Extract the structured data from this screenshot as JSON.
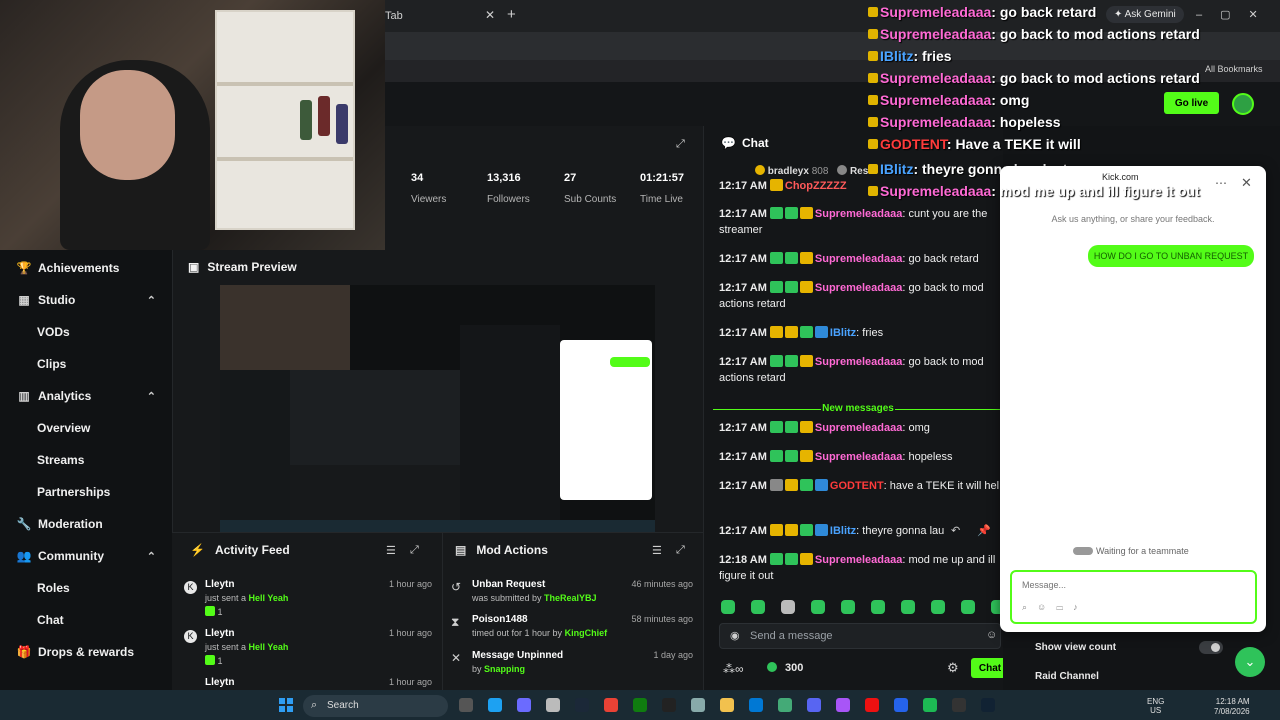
{
  "browser": {
    "tab_title": "Tab",
    "ask_gemini": "Ask Gemini",
    "all_bookmarks": "All Bookmarks",
    "go_live": "Go live"
  },
  "stats": [
    {
      "value": "34",
      "label": "Viewers"
    },
    {
      "value": "13,316",
      "label": "Followers"
    },
    {
      "value": "27",
      "label": "Sub Counts"
    },
    {
      "value": "01:21:57",
      "label": "Time Live"
    }
  ],
  "sidebar": {
    "items": [
      {
        "label": "Achievements",
        "icon": "trophy-icon"
      },
      {
        "label": "Studio",
        "icon": "studio-icon"
      },
      {
        "label": "VODs"
      },
      {
        "label": "Clips"
      },
      {
        "label": "Analytics",
        "icon": "chart-icon"
      },
      {
        "label": "Overview"
      },
      {
        "label": "Streams"
      },
      {
        "label": "Partnerships"
      },
      {
        "label": "Moderation",
        "icon": "wrench-icon"
      },
      {
        "label": "Community",
        "icon": "people-icon"
      },
      {
        "label": "Roles"
      },
      {
        "label": "Chat"
      },
      {
        "label": "Drops & rewards",
        "icon": "gift-icon"
      }
    ]
  },
  "stream_preview": {
    "title": "Stream Preview"
  },
  "activity_feed": {
    "title": "Activity Feed",
    "rows": [
      {
        "name": "Lleytn",
        "action": "just sent a",
        "item": "Hell Yeah",
        "count": "1",
        "time": "1 hour ago"
      },
      {
        "name": "Lleytn",
        "action": "just sent a",
        "item": "Hell Yeah",
        "count": "1",
        "time": "1 hour ago"
      },
      {
        "name": "Lleytn",
        "time": "1 hour ago"
      }
    ]
  },
  "mod_actions": {
    "title": "Mod Actions",
    "rows": [
      {
        "name": "Unban Request",
        "detail": "was submitted by",
        "by": "TheRealYBJ",
        "time": "46 minutes ago"
      },
      {
        "name": "Poison1488",
        "detail": "timed out for 1 hour by",
        "by": "KingChief",
        "time": "58 minutes ago"
      },
      {
        "name": "Message Unpinned",
        "detail": "by",
        "by": "Snapping",
        "time": "1 day ago"
      }
    ]
  },
  "chat": {
    "title": "Chat",
    "pinned_user": "bradleyx",
    "pinned_count": "808",
    "pinned_extra": "Resid",
    "messages": [
      {
        "time": "12:17 AM",
        "user": "ChopZZZZZ",
        "text": "",
        "color": "#ff5a5a",
        "badges": [
          "#e6b400"
        ]
      },
      {
        "time": "12:17 AM",
        "user": "Supremeleadaaa",
        "text": "cunt you are the streamer",
        "color": "#ff6ad5",
        "badges": [
          "#2fc35a",
          "#2fc35a",
          "#e6b400"
        ]
      },
      {
        "time": "12:17 AM",
        "user": "Supremeleadaaa",
        "text": "go back retard",
        "color": "#ff6ad5",
        "badges": [
          "#2fc35a",
          "#2fc35a",
          "#e6b400"
        ]
      },
      {
        "time": "12:17 AM",
        "user": "Supremeleadaaa",
        "text": "go back to mod actions retard",
        "color": "#ff6ad5",
        "badges": [
          "#2fc35a",
          "#2fc35a",
          "#e6b400"
        ]
      },
      {
        "time": "12:17 AM",
        "user": "IBlitz",
        "text": "fries",
        "color": "#4aa3ff",
        "badges": [
          "#e6b400",
          "#e6b400",
          "#2fc35a",
          "#2f8ad8"
        ]
      },
      {
        "time": "12:17 AM",
        "user": "Supremeleadaaa",
        "text": "go back to mod actions retard",
        "color": "#ff6ad5",
        "badges": [
          "#2fc35a",
          "#2fc35a",
          "#e6b400"
        ]
      },
      {
        "time": "12:17 AM",
        "user": "Supremeleadaaa",
        "text": "omg",
        "color": "#ff6ad5",
        "badges": [
          "#2fc35a",
          "#2fc35a",
          "#e6b400"
        ]
      },
      {
        "time": "12:17 AM",
        "user": "Supremeleadaaa",
        "text": "hopeless",
        "color": "#ff6ad5",
        "badges": [
          "#2fc35a",
          "#2fc35a",
          "#e6b400"
        ]
      },
      {
        "time": "12:17 AM",
        "user": "GODTENT",
        "text": "have a TEKE it will hel",
        "color": "#ff3b3b",
        "badges": [
          "#888888",
          "#e6b400",
          "#2fc35a",
          "#2f8ad8"
        ]
      },
      {
        "time": "12:17 AM",
        "user": "IBlitz",
        "text": "theyre gonna lau",
        "color": "#4aa3ff",
        "badges": [
          "#e6b400",
          "#e6b400",
          "#2fc35a",
          "#2f8ad8"
        ]
      },
      {
        "time": "12:18 AM",
        "user": "Supremeleadaaa",
        "text": "mod me up and ill figure it out",
        "color": "#ff6ad5",
        "badges": [
          "#2fc35a",
          "#2fc35a",
          "#e6b400"
        ]
      }
    ],
    "new_messages": "New messages",
    "send_placeholder": "Send a message",
    "kicks": "300",
    "chat_button": "Chat"
  },
  "overlay": [
    {
      "user": "Supremeleadaaa",
      "text": ": go back retard"
    },
    {
      "user": "Supremeleadaaa",
      "text": ": go back to mod actions retard"
    },
    {
      "user": "IBlitz",
      "text": ": fries"
    },
    {
      "user": "Supremeleadaaa",
      "text": ": go back to mod actions retard"
    },
    {
      "user": "Supremeleadaaa",
      "text": ": omg"
    },
    {
      "user": "Supremeleadaaa",
      "text": ": hopeless"
    },
    {
      "user": "GODTENT",
      "text": ": Have a TEKE it will"
    },
    {
      "user": "IBlitz",
      "text": ": theyre gonna laugh at you"
    },
    {
      "user": "Supremeleadaaa",
      "text": ": mod me up and ill figure it out"
    }
  ],
  "support": {
    "brand": "Kick.com",
    "hint": "Ask us anything, or share your feedback.",
    "user_message": "HOW DO I GO TO UNBAN REQUEST",
    "waiting": "Waiting for a teammate",
    "placeholder": "Message..."
  },
  "right_panel": {
    "show_view_count": "Show view count",
    "raid_channel": "Raid Channel"
  },
  "taskbar": {
    "search": "Search",
    "lang_top": "ENG",
    "lang_bottom": "US",
    "time": "12:18 AM",
    "date": "7/08/2026"
  }
}
